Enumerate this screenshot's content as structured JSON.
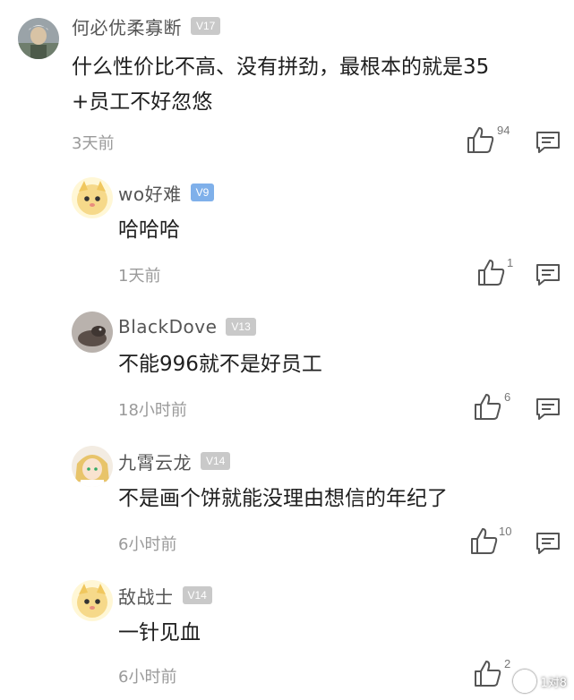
{
  "comments": [
    {
      "username": "何必优柔寡断",
      "badge": "V17",
      "content_line1": "什么性价比不高、没有拼劲，最根本的就是35",
      "content_line2": "+员工不好忽悠",
      "time": "3天前",
      "likes": "94"
    },
    {
      "username": "wo好难",
      "badge": "V9",
      "content": "哈哈哈",
      "time": "1天前",
      "likes": "1"
    },
    {
      "username": "BlackDove",
      "badge": "V13",
      "content": "不能996就不是好员工",
      "time": "18小时前",
      "likes": "6"
    },
    {
      "username": "九霄云龙",
      "badge": "V14",
      "content": "不是画个饼就能没理由想信的年纪了",
      "time": "6小时前",
      "likes": "10"
    },
    {
      "username": "敌战士",
      "badge": "V14",
      "content": "一针见血",
      "time": "6小时前",
      "likes": "2"
    }
  ],
  "watermark": "1对8",
  "colors": {
    "badge_gray": "#c9c9c9",
    "badge_blue": "#7fb0ea"
  }
}
